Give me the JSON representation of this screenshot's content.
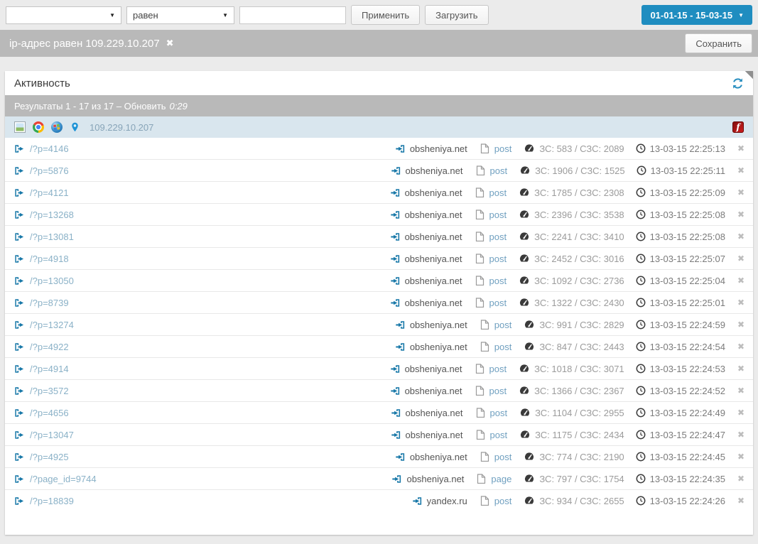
{
  "toolbar": {
    "field_select_value": "",
    "operator_select_value": "равен",
    "value_input_value": "",
    "apply_label": "Применить",
    "load_label": "Загрузить",
    "date_range_label": "01-01-15 - 15-03-15"
  },
  "filter_bar": {
    "active_filter": "ip-адрес равен 109.229.10.207",
    "save_label": "Сохранить"
  },
  "panel": {
    "title": "Активность",
    "results_text": "Результаты 1 - 17 из 17 – Обновить",
    "refresh_countdown": "0:29",
    "visitor": {
      "ip": "109.229.10.207",
      "icons": [
        "image-icon",
        "chrome-icon",
        "windows-icon",
        "location-pin-icon"
      ],
      "right_icon": "flash-icon",
      "flash_glyph": "f"
    },
    "rows": [
      {
        "url": "/?p=4146",
        "site": "obsheniya.net",
        "type": "post",
        "speed": "ЗС: 583 / СЗС: 2089",
        "time": "13-03-15 22:25:13"
      },
      {
        "url": "/?p=5876",
        "site": "obsheniya.net",
        "type": "post",
        "speed": "ЗС: 1906 / СЗС: 1525",
        "time": "13-03-15 22:25:11"
      },
      {
        "url": "/?p=4121",
        "site": "obsheniya.net",
        "type": "post",
        "speed": "ЗС: 1785 / СЗС: 2308",
        "time": "13-03-15 22:25:09"
      },
      {
        "url": "/?p=13268",
        "site": "obsheniya.net",
        "type": "post",
        "speed": "ЗС: 2396 / СЗС: 3538",
        "time": "13-03-15 22:25:08"
      },
      {
        "url": "/?p=13081",
        "site": "obsheniya.net",
        "type": "post",
        "speed": "ЗС: 2241 / СЗС: 3410",
        "time": "13-03-15 22:25:08"
      },
      {
        "url": "/?p=4918",
        "site": "obsheniya.net",
        "type": "post",
        "speed": "ЗС: 2452 / СЗС: 3016",
        "time": "13-03-15 22:25:07"
      },
      {
        "url": "/?p=13050",
        "site": "obsheniya.net",
        "type": "post",
        "speed": "ЗС: 1092 / СЗС: 2736",
        "time": "13-03-15 22:25:04"
      },
      {
        "url": "/?p=8739",
        "site": "obsheniya.net",
        "type": "post",
        "speed": "ЗС: 1322 / СЗС: 2430",
        "time": "13-03-15 22:25:01"
      },
      {
        "url": "/?p=13274",
        "site": "obsheniya.net",
        "type": "post",
        "speed": "ЗС: 991 / СЗС: 2829",
        "time": "13-03-15 22:24:59"
      },
      {
        "url": "/?p=4922",
        "site": "obsheniya.net",
        "type": "post",
        "speed": "ЗС: 847 / СЗС: 2443",
        "time": "13-03-15 22:24:54"
      },
      {
        "url": "/?p=4914",
        "site": "obsheniya.net",
        "type": "post",
        "speed": "ЗС: 1018 / СЗС: 3071",
        "time": "13-03-15 22:24:53"
      },
      {
        "url": "/?p=3572",
        "site": "obsheniya.net",
        "type": "post",
        "speed": "ЗС: 1366 / СЗС: 2367",
        "time": "13-03-15 22:24:52"
      },
      {
        "url": "/?p=4656",
        "site": "obsheniya.net",
        "type": "post",
        "speed": "ЗС: 1104 / СЗС: 2955",
        "time": "13-03-15 22:24:49"
      },
      {
        "url": "/?p=13047",
        "site": "obsheniya.net",
        "type": "post",
        "speed": "ЗС: 1175 / СЗС: 2434",
        "time": "13-03-15 22:24:47"
      },
      {
        "url": "/?p=4925",
        "site": "obsheniya.net",
        "type": "post",
        "speed": "ЗС: 774 / СЗС: 2190",
        "time": "13-03-15 22:24:45"
      },
      {
        "url": "/?page_id=9744",
        "site": "obsheniya.net",
        "type": "page",
        "speed": "ЗС: 797 / СЗС: 1754",
        "time": "13-03-15 22:24:35"
      },
      {
        "url": "/?p=18839",
        "site": "yandex.ru",
        "type": "post",
        "speed": "ЗС: 934 / СЗС: 2655",
        "time": "13-03-15 22:24:26"
      }
    ]
  },
  "glyphs": {
    "close": "✖",
    "caret_down": "▼"
  },
  "colors": {
    "accent_blue": "#1f8dc0",
    "icon_blue": "#1878a8",
    "refresh_blue": "#2a8fc0",
    "url_link": "#8ab1c7",
    "type_link": "#70a0c0",
    "bar_gray": "#b9b9b9",
    "visitor_row_bg": "#d9e6ee",
    "flash_red": "#c00000",
    "page_bg": "#ebebeb"
  }
}
